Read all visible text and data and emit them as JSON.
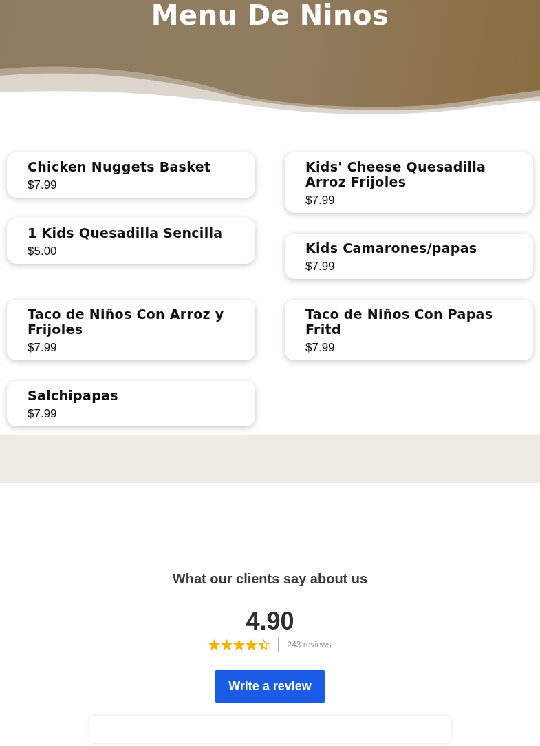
{
  "page_title": "Menu De Ninos",
  "menu_items": [
    {
      "name": "Chicken Nuggets Basket",
      "price": "$7.99"
    },
    {
      "name": "Kids' Cheese Quesadilla Arroz Frijoles",
      "price": "$7.99"
    },
    {
      "name": "1 Kids Quesadilla Sencilla",
      "price": "$5.00"
    },
    {
      "name": "Kids Camarones/papas",
      "price": "$7.99"
    },
    {
      "name": "Taco de Niños Con Arroz y Frijoles",
      "price": "$7.99"
    },
    {
      "name": "Taco de Niños Con Papas Fritd",
      "price": "$7.99"
    },
    {
      "name": "Salchipapas",
      "price": "$7.99"
    }
  ],
  "reviews": {
    "heading": "What our clients say about us",
    "rating": "4.90",
    "stars": 4.5,
    "count": "243 reviews",
    "button": "Write a review"
  }
}
